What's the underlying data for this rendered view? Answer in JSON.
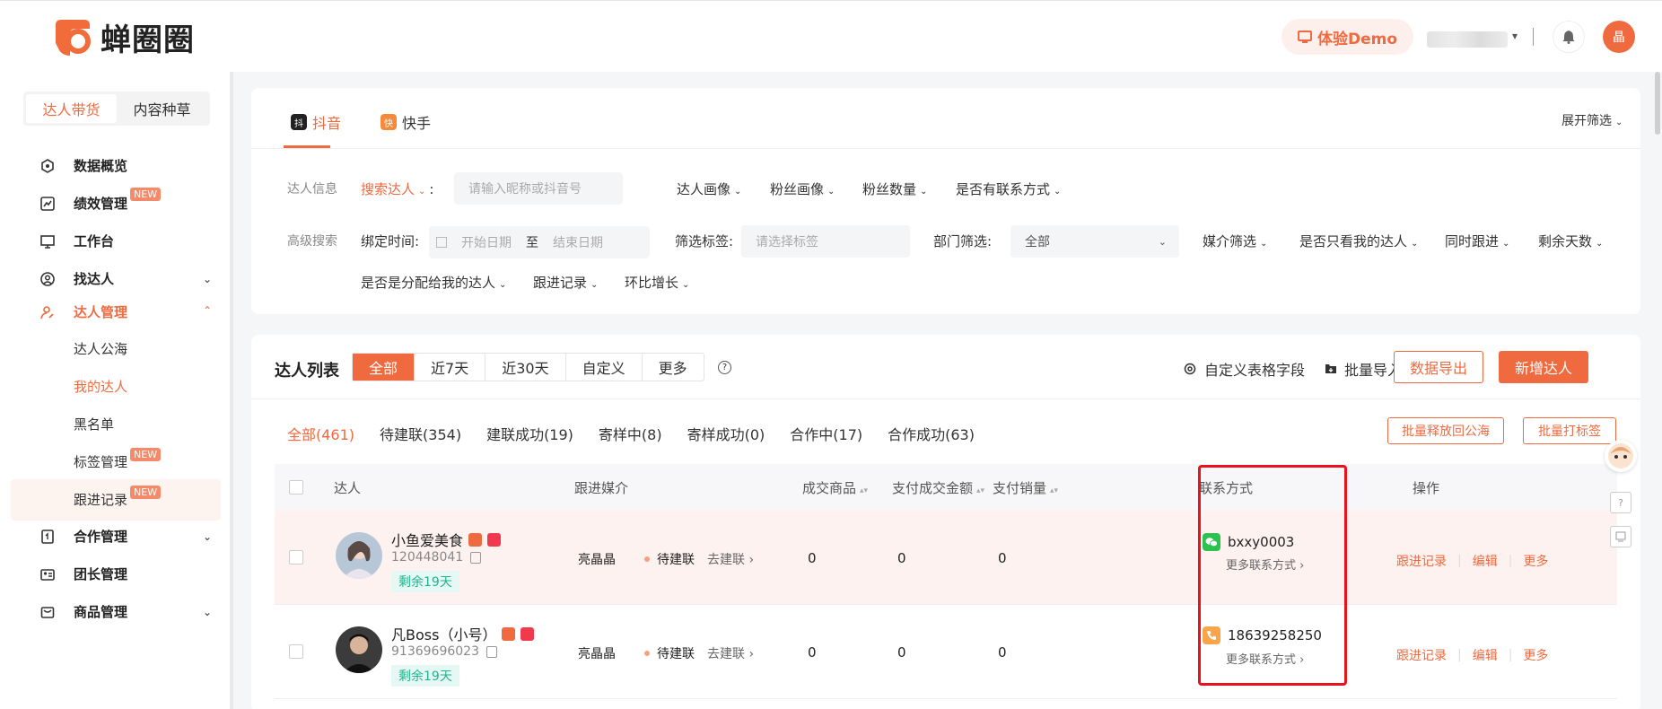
{
  "header": {
    "logo_text": "蝉圈圈",
    "demo_label": "体验Demo",
    "avatar_text": "晶"
  },
  "sidebar": {
    "mode_tabs": [
      "达人带货",
      "内容种草"
    ],
    "items": [
      {
        "label": "数据概览",
        "icon": "dashboard-icon"
      },
      {
        "label": "绩效管理",
        "icon": "chart-icon",
        "badge": "NEW"
      },
      {
        "label": "工作台",
        "icon": "monitor-icon"
      },
      {
        "label": "找达人",
        "icon": "user-search-icon"
      },
      {
        "label": "达人管理",
        "icon": "user-edit-icon"
      },
      {
        "label": "合作管理",
        "icon": "doc-icon"
      },
      {
        "label": "团长管理",
        "icon": "team-icon"
      },
      {
        "label": "商品管理",
        "icon": "bag-icon"
      }
    ],
    "sub_items": [
      {
        "label": "达人公海"
      },
      {
        "label": "我的达人"
      },
      {
        "label": "黑名单"
      },
      {
        "label": "标签管理",
        "badge": "NEW"
      },
      {
        "label": "跟进记录",
        "badge": "NEW"
      }
    ]
  },
  "filters": {
    "platforms": [
      "抖音",
      "快手"
    ],
    "platform_icons": [
      "抖",
      "快"
    ],
    "expand": "展开筛选",
    "info_label": "达人信息",
    "search_mode": "搜索达人",
    "search_colon": ":",
    "search_placeholder": "请输入昵称或抖音号",
    "dropdowns_row1": [
      "达人画像",
      "粉丝画像",
      "粉丝数量",
      "是否有联系方式"
    ],
    "advanced_label": "高级搜索",
    "bind_time_label": "绑定时间:",
    "start_date": "开始日期",
    "to": "至",
    "end_date": "结束日期",
    "tag_label": "筛选标签:",
    "tag_placeholder": "请选择标签",
    "dept_label": "部门筛选:",
    "dept_value": "全部",
    "dropdowns_row2": [
      "媒介筛选",
      "是否只看我的达人",
      "同时跟进",
      "剩余天数"
    ],
    "dropdowns_row3": [
      "是否是分配给我的达人",
      "跟进记录",
      "环比增长"
    ]
  },
  "list": {
    "title": "达人列表",
    "range_tabs": [
      "全部",
      "近7天",
      "近30天",
      "自定义",
      "更多"
    ],
    "custom_fields": "自定义表格字段",
    "batch_import": "批量导入",
    "export": "数据导出",
    "add_new": "新增达人",
    "status_tabs": [
      "全部(461)",
      "待建联(354)",
      "建联成功(19)",
      "寄样中(8)",
      "寄样成功(0)",
      "合作中(17)",
      "合作成功(63)"
    ],
    "release_btn": "批量释放回公海",
    "tag_btn": "批量打标签",
    "columns": {
      "influencer": "达人",
      "media": "跟进媒介",
      "goods": "成交商品",
      "gmv": "支付成交金额",
      "sales": "支付销量",
      "contact": "联系方式",
      "ops": "操作"
    },
    "rows": [
      {
        "name": "小鱼爱美食",
        "uid": "120448041",
        "remain": "剩余19天",
        "media": "亮晶晶",
        "status": "待建联",
        "action": "去建联",
        "goods": "0",
        "gmv": "0",
        "sales": "0",
        "contact": "bxxy0003",
        "contact_icon": "wechat-icon",
        "more": "更多联系方式",
        "ops": [
          "跟进记录",
          "编辑",
          "更多"
        ]
      },
      {
        "name": "凡Boss（小号）",
        "uid": "91369696023",
        "remain": "剩余19天",
        "media": "亮晶晶",
        "status": "待建联",
        "action": "去建联",
        "goods": "0",
        "gmv": "0",
        "sales": "0",
        "contact": "18639258250",
        "contact_icon": "phone-icon",
        "more": "更多联系方式",
        "ops": [
          "跟进记录",
          "编辑",
          "更多"
        ]
      }
    ]
  },
  "colors": {
    "accent": "#f06a3f",
    "highlight_box": "#e8131c",
    "remain_text": "#1fb38f"
  }
}
